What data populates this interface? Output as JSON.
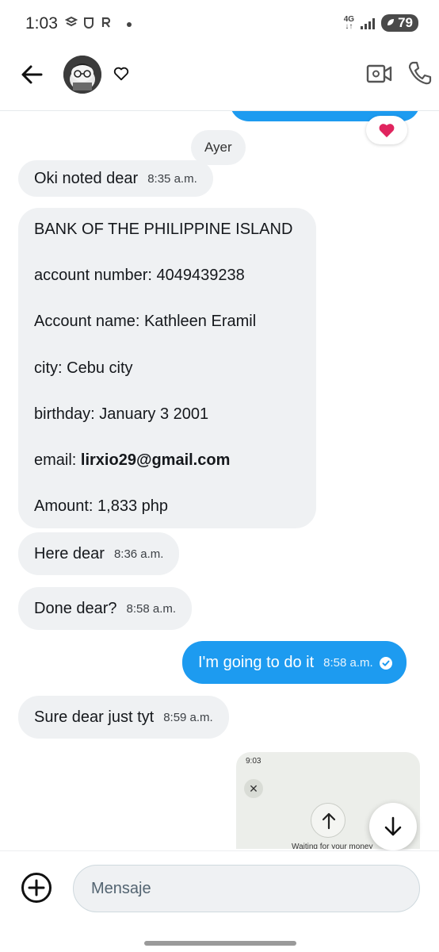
{
  "status_bar": {
    "time": "1:03",
    "network": "4G",
    "battery": "79"
  },
  "header": {
    "avatar_icon": "avatar-image",
    "back_icon": "arrow-left-icon",
    "heart_icon": "heart-outline-icon",
    "video_icon": "video-call-icon",
    "phone_icon": "phone-call-icon"
  },
  "conversation": {
    "date_separator": "Ayer",
    "reaction": "❤️",
    "messages": [
      {
        "text": "Oki noted dear",
        "time": "8:35 a.m."
      },
      {
        "text": "Here dear",
        "time": "8:36 a.m."
      },
      {
        "text": "Done dear?",
        "time": "8:58 a.m."
      },
      {
        "text": "I'm going to do it",
        "time": "8:58 a.m."
      },
      {
        "text": "Sure dear just tyt",
        "time": "8:59 a.m."
      }
    ],
    "bank_message": {
      "line1": "BANK OF THE PHILIPPINE ISLAND",
      "account_number_label": "account number: ",
      "account_number": "4049439238",
      "account_name_label": "Account name: ",
      "account_name": "Kathleen Eramil",
      "city_label": "city: ",
      "city": "Cebu city",
      "birthday_label": "birthday: ",
      "birthday": "January 3 2001",
      "email_label": "email: ",
      "email": "lirxio29@gmail.com",
      "amount_label": "Amount: ",
      "amount": "1,833 php"
    },
    "media_preview": {
      "status_time": "9:03",
      "caption": "Waiting for your money"
    }
  },
  "composer": {
    "placeholder": "Mensaje"
  },
  "colors": {
    "accent": "#1d9bf0",
    "incoming_bubble": "#eff1f3"
  }
}
